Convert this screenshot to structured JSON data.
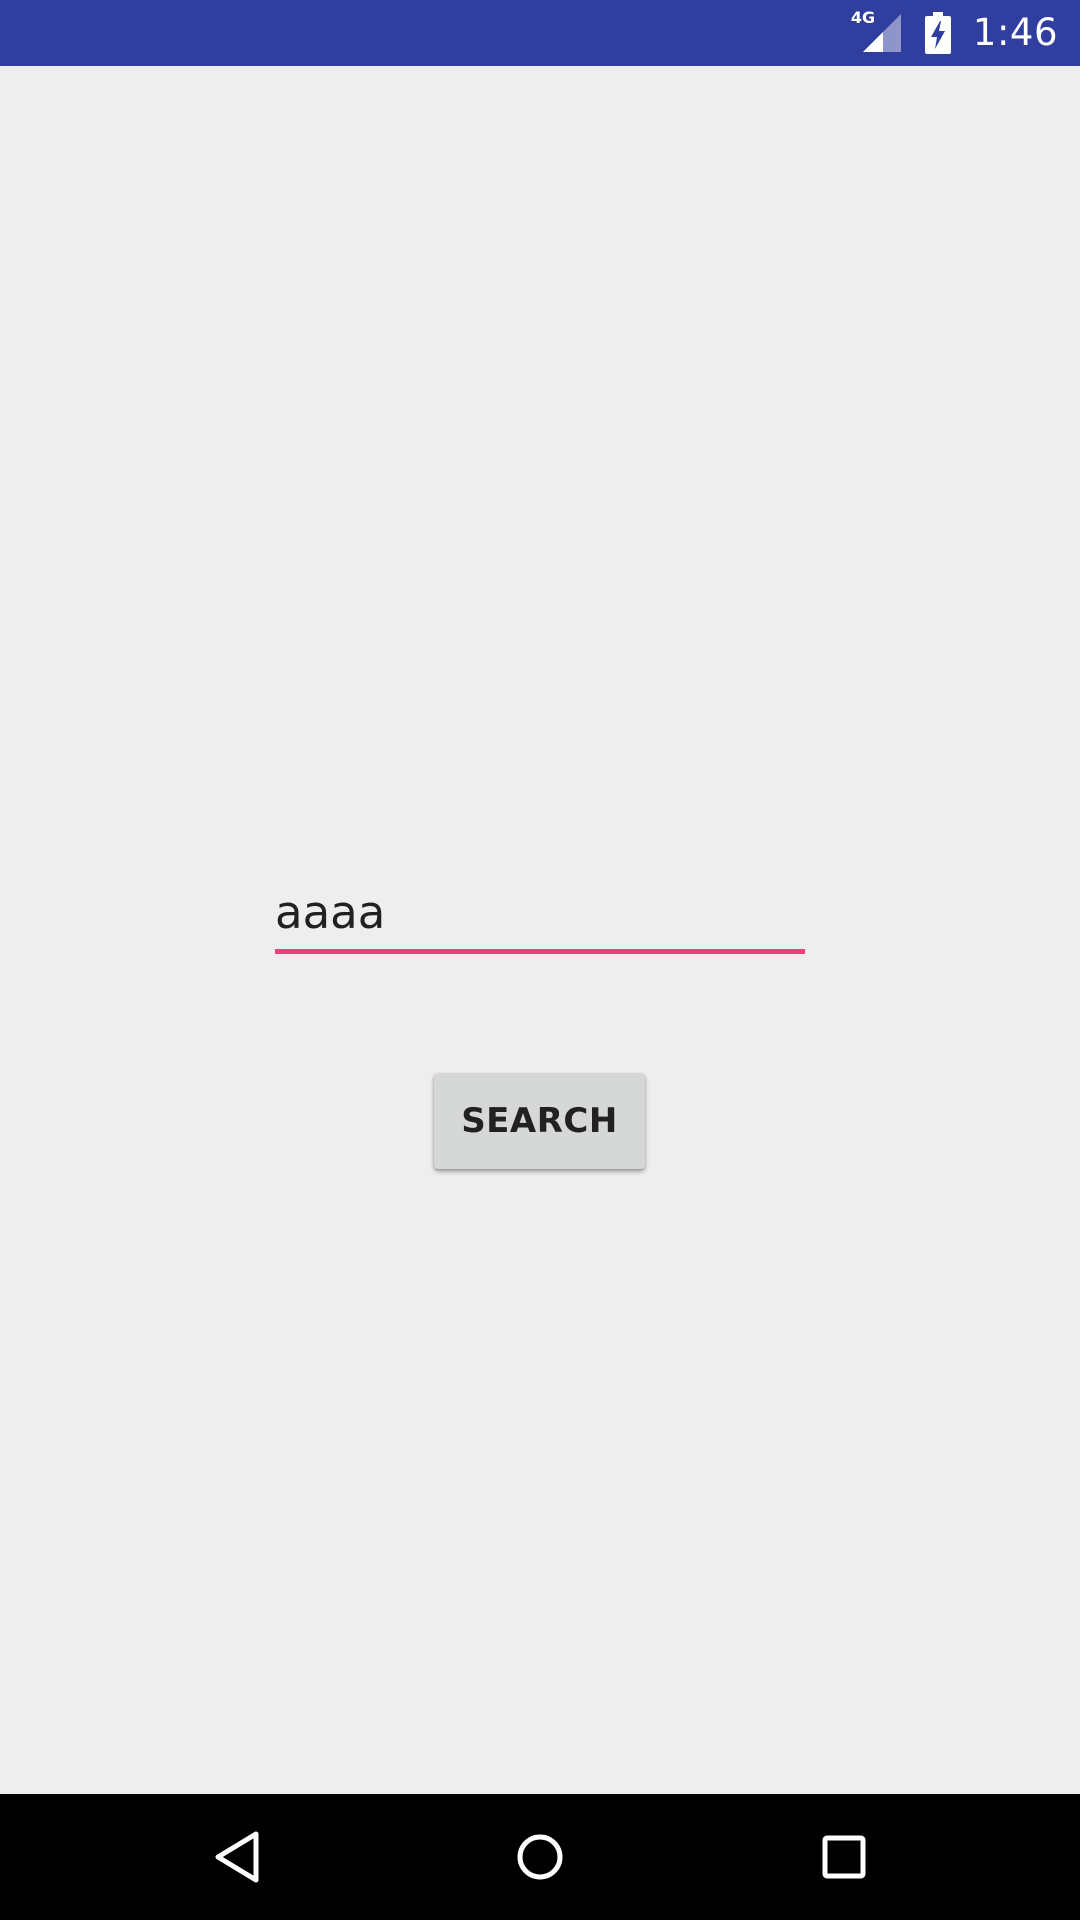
{
  "status_bar": {
    "network_label": "4G",
    "time": "1:46",
    "background": "#303f9f",
    "icons": [
      "signal-icon",
      "battery-charging-icon"
    ]
  },
  "search": {
    "input_value": "aaaa",
    "underline_color": "#ec407a",
    "button_label": "SEARCH"
  },
  "nav_bar": {
    "icons": [
      "back-icon",
      "home-icon",
      "recents-icon"
    ]
  }
}
